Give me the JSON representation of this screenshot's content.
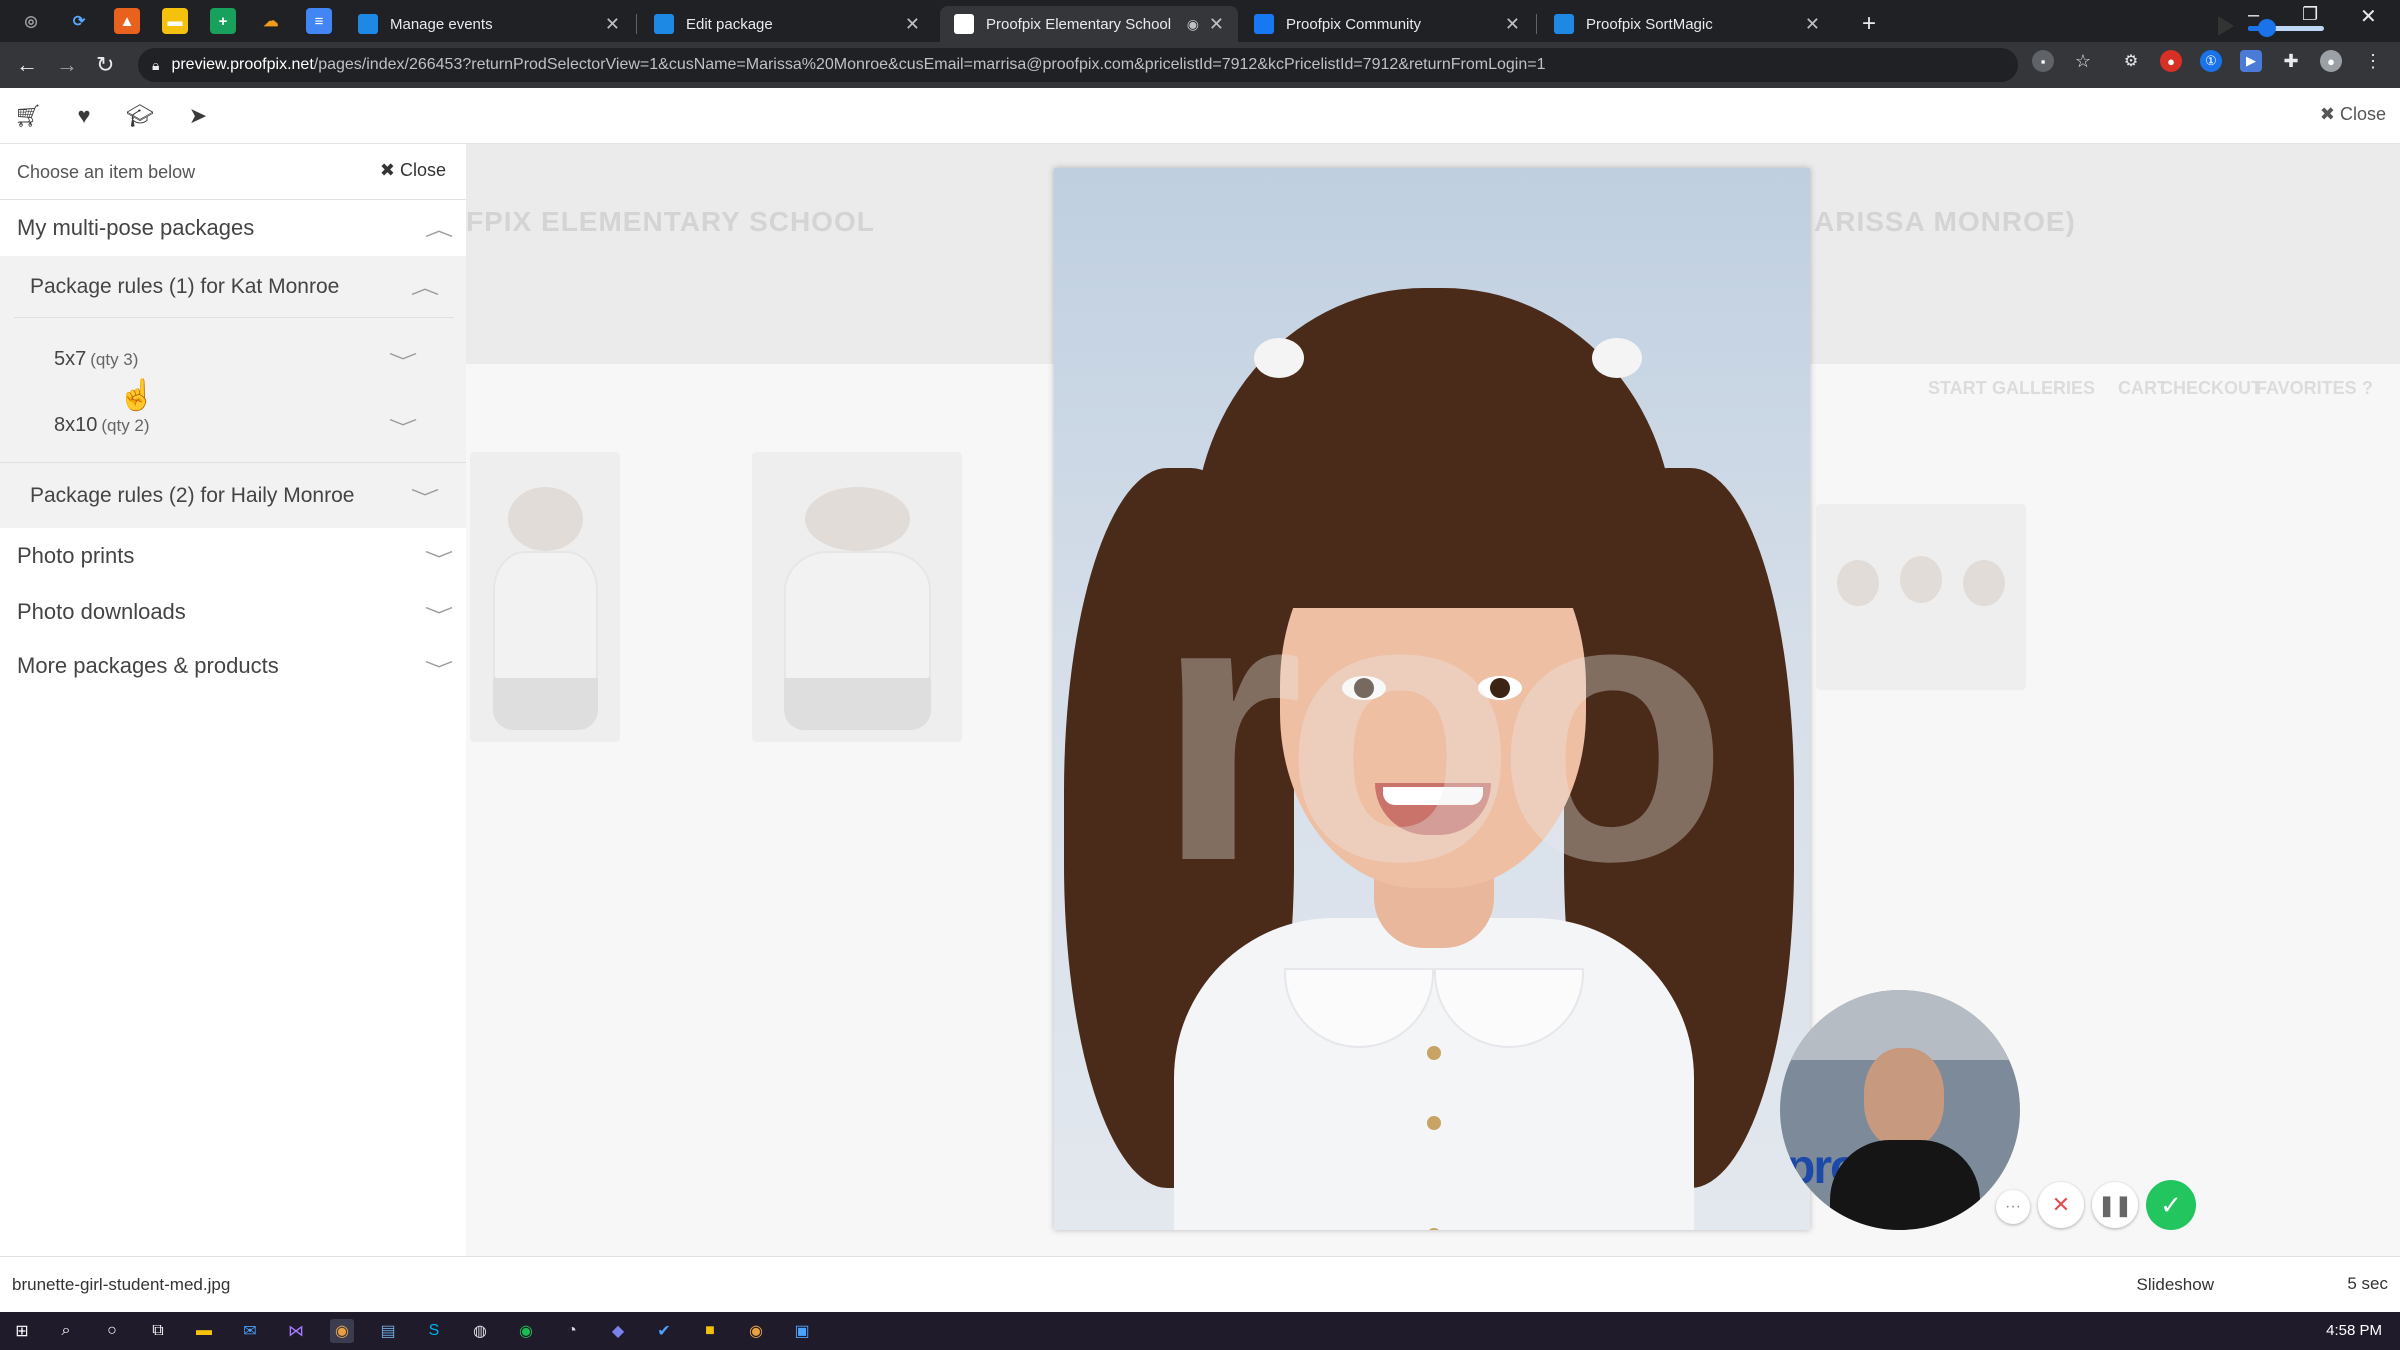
{
  "browser": {
    "tabs": [
      {
        "title": "Manage events"
      },
      {
        "title": "Edit package"
      },
      {
        "title": "Proofpix Elementary School"
      },
      {
        "title": "Proofpix Community"
      },
      {
        "title": "Proofpix SortMagic"
      }
    ],
    "new_tab": "+",
    "url_host": "preview.proofpix.net",
    "url_path": "/pages/index/266453?returnProdSelectorView=1&cusName=Marissa%20Monroe&cusEmail=marrisa@proofpix.com&pricelistId=7912&kcPricelistId=7912&returnFromLogin=1"
  },
  "app_top": {
    "close_label": "Close"
  },
  "background_page": {
    "school_title": "FPIX ELEMENTARY SCHOOL",
    "customer_title": "ARISSA MONROE)",
    "nav": [
      "START",
      "GALLERIES",
      "CART",
      "CHECKOUT",
      "FAVORITES"
    ],
    "watermark": "roo"
  },
  "panel": {
    "header_text": "Choose an item below",
    "close_label": "Close",
    "multi_pose_label": "My multi-pose packages",
    "rule1_label": "Package rules (1) for Kat Monroe",
    "items": [
      {
        "size": "5x7",
        "qty": "(qty 3)"
      },
      {
        "size": "8x10",
        "qty": "(qty 2)"
      }
    ],
    "rule2_label": "Package rules (2) for Haily Monroe",
    "categories": [
      {
        "label": "Photo prints"
      },
      {
        "label": "Photo downloads"
      },
      {
        "label": "More packages & products"
      }
    ]
  },
  "statusbar": {
    "filename": "brunette-girl-student-med.jpg",
    "slideshow_label": "Slideshow",
    "slideshow_seconds": "5 sec",
    "slider_level": 0.25
  },
  "webcam": {
    "backdrop_text": "proof"
  },
  "taskbar": {
    "clock": "4:58 PM"
  },
  "colors": {
    "accent_green": "#22c55e",
    "accent_blue": "#1a73e8"
  }
}
